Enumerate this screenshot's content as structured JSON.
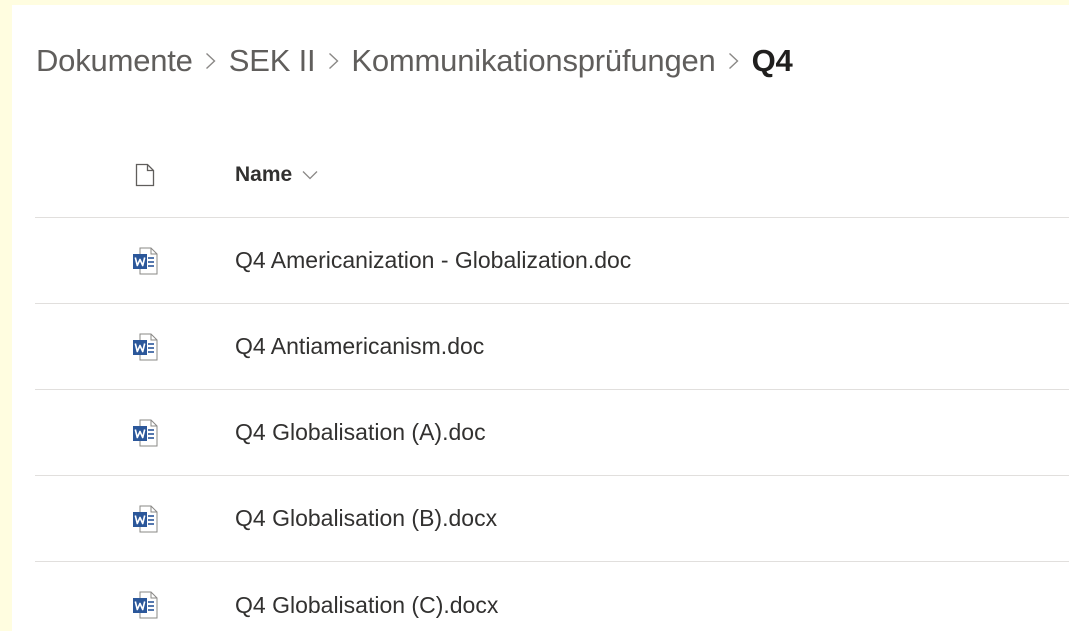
{
  "breadcrumb": {
    "items": [
      "Dokumente",
      "SEK II",
      "Kommunikationsprüfungen"
    ],
    "current": "Q4"
  },
  "list": {
    "column_header": "Name",
    "header_icon": "document-icon",
    "sort_icon": "chevron-down-icon",
    "files": [
      {
        "name": "Q4 Americanization - Globalization.doc",
        "icon": "word-file-icon"
      },
      {
        "name": "Q4 Antiamericanism.doc",
        "icon": "word-file-icon"
      },
      {
        "name": "Q4 Globalisation (A).doc",
        "icon": "word-file-icon"
      },
      {
        "name": "Q4 Globalisation (B).docx",
        "icon": "word-file-icon"
      },
      {
        "name": "Q4 Globalisation (C).docx",
        "icon": "word-file-icon"
      }
    ]
  },
  "colors": {
    "page_border": "#fffde0",
    "word_blue": "#2b579a",
    "divider": "#e1dfdd",
    "text": "#323130"
  }
}
